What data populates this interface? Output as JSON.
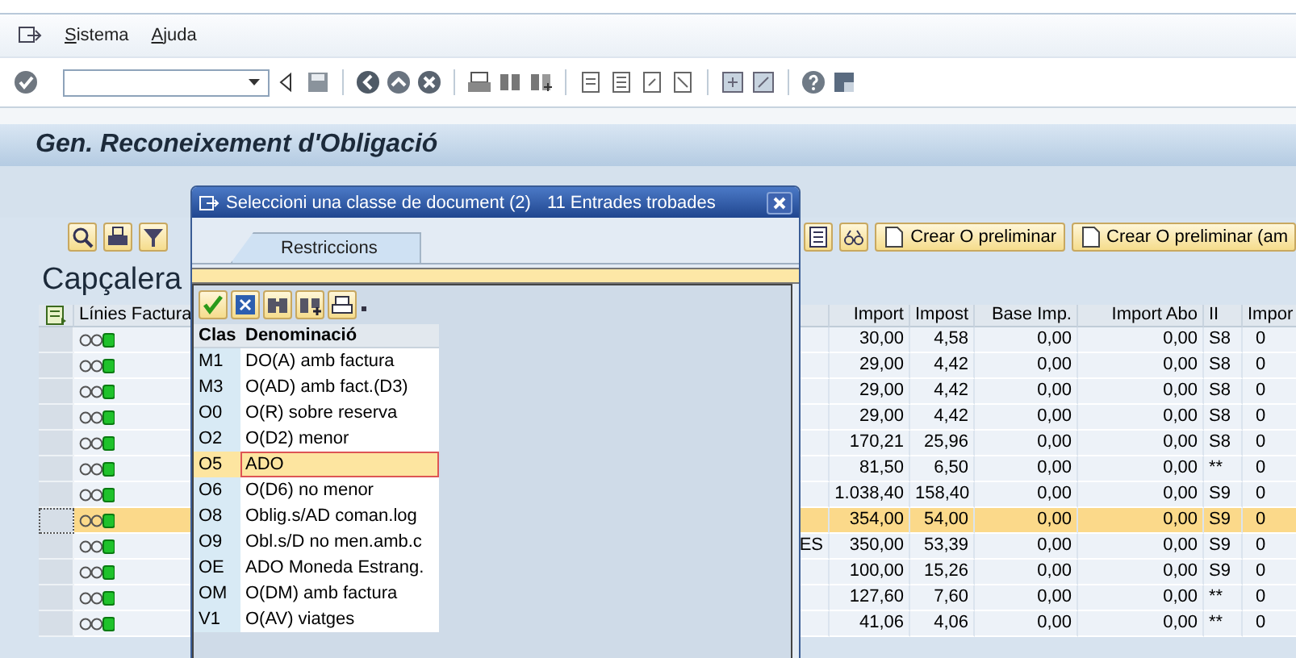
{
  "menu": [
    {
      "label": "Sistema"
    },
    {
      "label": "Ajuda"
    }
  ],
  "title": "Gen. Reconeixement d'Obligació",
  "app_toolbar": {
    "buttons": [
      {
        "label": "Crear O preliminar"
      },
      {
        "label": "Crear O preliminar (am"
      }
    ]
  },
  "section_title": "Capçalera",
  "table": {
    "columns": [
      "Línies Factura",
      "Import",
      "Impost",
      "Base Imp.",
      "Import Abo",
      "II",
      "Impor"
    ],
    "rows": [
      {
        "selected": false,
        "column_3": "",
        "import": "30,00",
        "impost": "4,58",
        "base": "0,00",
        "abo": "0,00",
        "ii": "S8",
        "last": "0"
      },
      {
        "selected": false,
        "column_3": "",
        "import": "29,00",
        "impost": "4,42",
        "base": "0,00",
        "abo": "0,00",
        "ii": "S8",
        "last": "0"
      },
      {
        "selected": false,
        "column_3": "",
        "import": "29,00",
        "impost": "4,42",
        "base": "0,00",
        "abo": "0,00",
        "ii": "S8",
        "last": "0"
      },
      {
        "selected": false,
        "column_3": "",
        "import": "29,00",
        "impost": "4,42",
        "base": "0,00",
        "abo": "0,00",
        "ii": "S8",
        "last": "0"
      },
      {
        "selected": false,
        "column_3": "",
        "import": "170,21",
        "impost": "25,96",
        "base": "0,00",
        "abo": "0,00",
        "ii": "S8",
        "last": "0"
      },
      {
        "selected": false,
        "column_3": "",
        "import": "81,50",
        "impost": "6,50",
        "base": "0,00",
        "abo": "0,00",
        "ii": "**",
        "last": "0"
      },
      {
        "selected": false,
        "column_3": "",
        "import": "1.038,40",
        "impost": "158,40",
        "base": "0,00",
        "abo": "0,00",
        "ii": "S9",
        "last": "0"
      },
      {
        "selected": true,
        "column_3": "",
        "import": "354,00",
        "impost": "54,00",
        "base": "0,00",
        "abo": "0,00",
        "ii": "S9",
        "last": "0"
      },
      {
        "selected": false,
        "column_3": "ES",
        "import": "350,00",
        "impost": "53,39",
        "base": "0,00",
        "abo": "0,00",
        "ii": "S9",
        "last": "0"
      },
      {
        "selected": false,
        "column_3": "",
        "import": "100,00",
        "impost": "15,26",
        "base": "0,00",
        "abo": "0,00",
        "ii": "S9",
        "last": "0"
      },
      {
        "selected": false,
        "column_3": "",
        "import": "127,60",
        "impost": "7,60",
        "base": "0,00",
        "abo": "0,00",
        "ii": "**",
        "last": "0"
      },
      {
        "selected": false,
        "column_3": "",
        "import": "41,06",
        "impost": "4,06",
        "base": "0,00",
        "abo": "0,00",
        "ii": "**",
        "last": "0"
      }
    ]
  },
  "dialog": {
    "title": "Seleccioni una classe de document (2)",
    "count": "11 Entrades trobades",
    "tabs": [
      {
        "label": "Restriccions",
        "selected": true
      }
    ],
    "columns": [
      "Clas",
      "Denominació"
    ],
    "rows": [
      {
        "code": "M1",
        "name": "DO(A) amb factura",
        "selected": false
      },
      {
        "code": "M3",
        "name": "O(AD) amb fact.(D3)",
        "selected": false
      },
      {
        "code": "O0",
        "name": "O(R) sobre reserva",
        "selected": false
      },
      {
        "code": "O2",
        "name": "O(D2) menor",
        "selected": false
      },
      {
        "code": "O5",
        "name": "ADO",
        "selected": true
      },
      {
        "code": "O6",
        "name": "O(D6) no menor",
        "selected": false
      },
      {
        "code": "O8",
        "name": "Oblig.s/AD coman.log",
        "selected": false
      },
      {
        "code": "O9",
        "name": "Obl.s/D no men.amb.c",
        "selected": false
      },
      {
        "code": "OE",
        "name": "ADO Moneda Estrang.",
        "selected": false
      },
      {
        "code": "OM",
        "name": "O(DM) amb factura",
        "selected": false
      },
      {
        "code": "V1",
        "name": "O(AV) viatges",
        "selected": false
      }
    ]
  }
}
